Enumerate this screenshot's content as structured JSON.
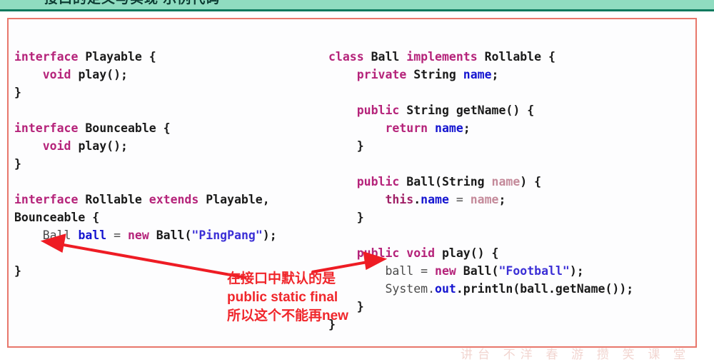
{
  "topbar": {
    "accent_color": "#0c7a5e",
    "background_color": "#8fdcc0",
    "cut_off_title": "接口的定义与实现 示例代码"
  },
  "panel": {
    "border_color": "#e8776b",
    "background_color": "#fdfdfe"
  },
  "code": {
    "left_column": "interface Playable {\n    void play();\n}\n\ninterface Bounceable {\n    void play();\n}\n\ninterface Rollable extends Playable,\nBounceable {\n    Ball ball = new Ball(\"PingPang\");\n\n}",
    "right_column": "class Ball implements Rollable {\n    private String name;\n\n    public String getName() {\n        return name;\n    }\n\n    public Ball(String name) {\n        this.name = name;\n    }\n\n    public void play() {\n        ball = new Ball(\"Football\");\n        System.out.println(ball.getName());\n    }\n}",
    "left_lines": [
      "interface Playable {",
      "    void play();",
      "}",
      "",
      "interface Bounceable {",
      "    void play();",
      "}",
      "",
      "interface Rollable extends Playable,",
      "Bounceable {",
      "    Ball ball = new Ball(\"PingPang\");",
      "",
      "}"
    ],
    "right_lines": [
      "class Ball implements Rollable {",
      "    private String name;",
      "",
      "    public String getName() {",
      "        return name;",
      "    }",
      "",
      "    public Ball(String name) {",
      "        this.name = name;",
      "    }",
      "",
      "    public void play() {",
      "        ball = new Ball(\"Football\");",
      "        System.out.println(ball.getName());",
      "    }",
      "}"
    ],
    "colors": {
      "keyword": "#b5237a",
      "identifier": "#1a1a1a",
      "field": "#1414d0",
      "string": "#3b2fd6",
      "parameter": "#c48a9a"
    }
  },
  "annotation": {
    "color": "#f0262b",
    "line1": "在接口中默认的是",
    "line2": "public static final",
    "line3": "所以这个不能再new",
    "full_text": "在接口中默认的是 public static final 所以这个不能再new"
  },
  "arrows": {
    "color": "#ee1c24",
    "left_arrow_label": "arrow pointing to interface field declaration",
    "right_arrow_label": "arrow pointing to ball reassignment in play()"
  },
  "watermark": {
    "text": "讲台 不洋 春 游 攒 笑 课 堂",
    "color": "#f2d6d1"
  }
}
